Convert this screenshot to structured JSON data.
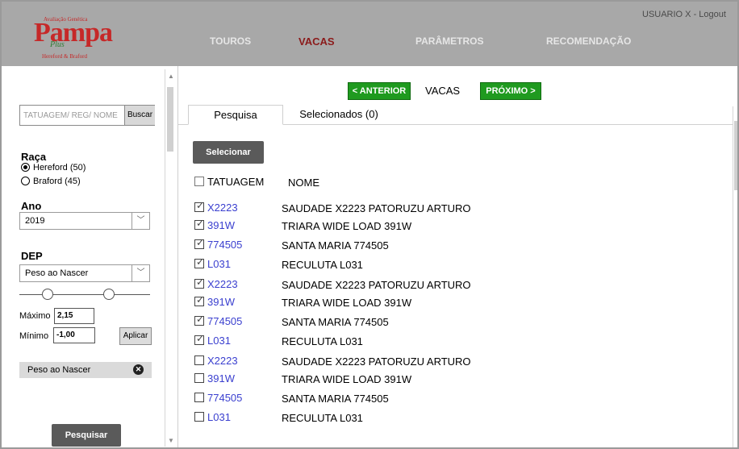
{
  "header": {
    "logo": {
      "top_text": "Avaliação Genética",
      "name": "Pampa",
      "plus": "Plus",
      "sub": "Hereford & Braford"
    },
    "nav": [
      {
        "label": "TOUROS",
        "active": false
      },
      {
        "label": "VACAS",
        "active": true
      },
      {
        "label": "PARÂMETROS",
        "active": false
      },
      {
        "label": "RECOMENDAÇÃO",
        "active": false
      }
    ],
    "user": "USUARIO X - Logout"
  },
  "sidebar": {
    "search": {
      "placeholder": "TATUAGEM/ REG/ NOME",
      "button": "Buscar"
    },
    "raca": {
      "title": "Raça",
      "options": [
        {
          "label": "Hereford (50)",
          "selected": true
        },
        {
          "label": "Braford (45)",
          "selected": false
        }
      ]
    },
    "ano": {
      "title": "Ano",
      "value": "2019"
    },
    "dep": {
      "title": "DEP",
      "value": "Peso ao Nascer",
      "slider_min_fraction": 0.19,
      "slider_max_fraction": 0.7,
      "max_label": "Máximo",
      "max_value": "2,15",
      "min_label": "Mínimo",
      "min_value": "-1,00",
      "apply": "Aplicar"
    },
    "active_filter": "Peso ao Nascer",
    "search_button": "Pesquisar"
  },
  "main": {
    "prev": "< ANTERIOR",
    "label": "VACAS",
    "next": "PRÓXIMO >",
    "tabs": [
      {
        "label": "Pesquisa",
        "active": true
      },
      {
        "label": "Selecionados (0)",
        "active": false
      }
    ],
    "select_button": "Selecionar",
    "columns": {
      "tag": "TATUAGEM",
      "name": "NOME"
    },
    "rows": [
      {
        "tag": "X2223",
        "name": "SAUDADE X2223 PATORUZU ARTURO",
        "checked": true
      },
      {
        "tag": "391W",
        "name": "TRIARA WIDE LOAD 391W",
        "checked": true
      },
      {
        "tag": "774505",
        "name": "SANTA MARIA 774505",
        "checked": true
      },
      {
        "tag": "L031",
        "name": "RECULUTA L031",
        "checked": true
      },
      {
        "tag": "X2223",
        "name": "SAUDADE X2223 PATORUZU ARTURO",
        "checked": true
      },
      {
        "tag": "391W",
        "name": "TRIARA WIDE LOAD 391W",
        "checked": true
      },
      {
        "tag": "774505",
        "name": "SANTA MARIA 774505",
        "checked": true
      },
      {
        "tag": "L031",
        "name": "RECULUTA L031",
        "checked": true
      },
      {
        "tag": "X2223",
        "name": "SAUDADE X2223 PATORUZU ARTURO",
        "checked": false
      },
      {
        "tag": "391W",
        "name": "TRIARA WIDE LOAD 391W",
        "checked": false
      },
      {
        "tag": "774505",
        "name": "SANTA MARIA 774505",
        "checked": false
      },
      {
        "tag": "L031",
        "name": "RECULUTA L031",
        "checked": false
      }
    ]
  }
}
